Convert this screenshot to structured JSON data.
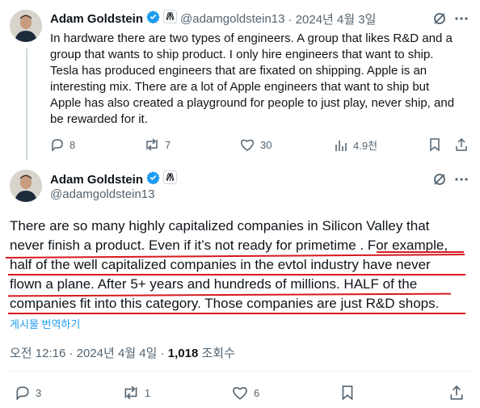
{
  "reply": {
    "author_name": "Adam Goldstein",
    "handle": "@adamgoldstein13",
    "time": "· 2024년 4월 3일",
    "text_lines": [
      "In hardware there are two types of engineers.  A group that likes R&D and a",
      "group that wants to ship product.   I only hire engineers that want to ship.",
      "Tesla has produced engineers that are fixated on shipping. Apple is an",
      "interesting mix. There are a lot of Apple engineers that want to ship but",
      "Apple has also created a playground for people to just play, never ship, and",
      "be rewarded for it."
    ],
    "actions": {
      "replies": "8",
      "reposts": "7",
      "likes": "30",
      "views": "4.9천"
    }
  },
  "main": {
    "author_name": "Adam Goldstein",
    "handle": "@adamgoldstein13",
    "text_lines": [
      {
        "a": "There are so many highly capitalized companies in Silicon Valley that",
        "b": ""
      },
      {
        "a": "never finish a product. Even if it’s not ready for primetime . ",
        "b": "For example,"
      },
      {
        "a": "",
        "b": "half of the well capitalized companies in the evtol industry have never"
      },
      {
        "a": "",
        "b": "flown a plane.  After 5+ years and hundreds of millions.  HALF of the"
      },
      {
        "a": "",
        "b": "companies fit into this category.  Those companies are just R&D shops."
      }
    ],
    "translate_label": "게시물 번역하기",
    "time": "오전 12:16 · 2024년 4월 4일 · ",
    "views_count": "1,018",
    "views_label": " 조회수",
    "actions": {
      "replies": "3",
      "reposts": "1",
      "likes": "6"
    }
  },
  "colors": {
    "verified": "#1d9bf0",
    "annotation": "#d7191f",
    "muted": "#536471"
  }
}
